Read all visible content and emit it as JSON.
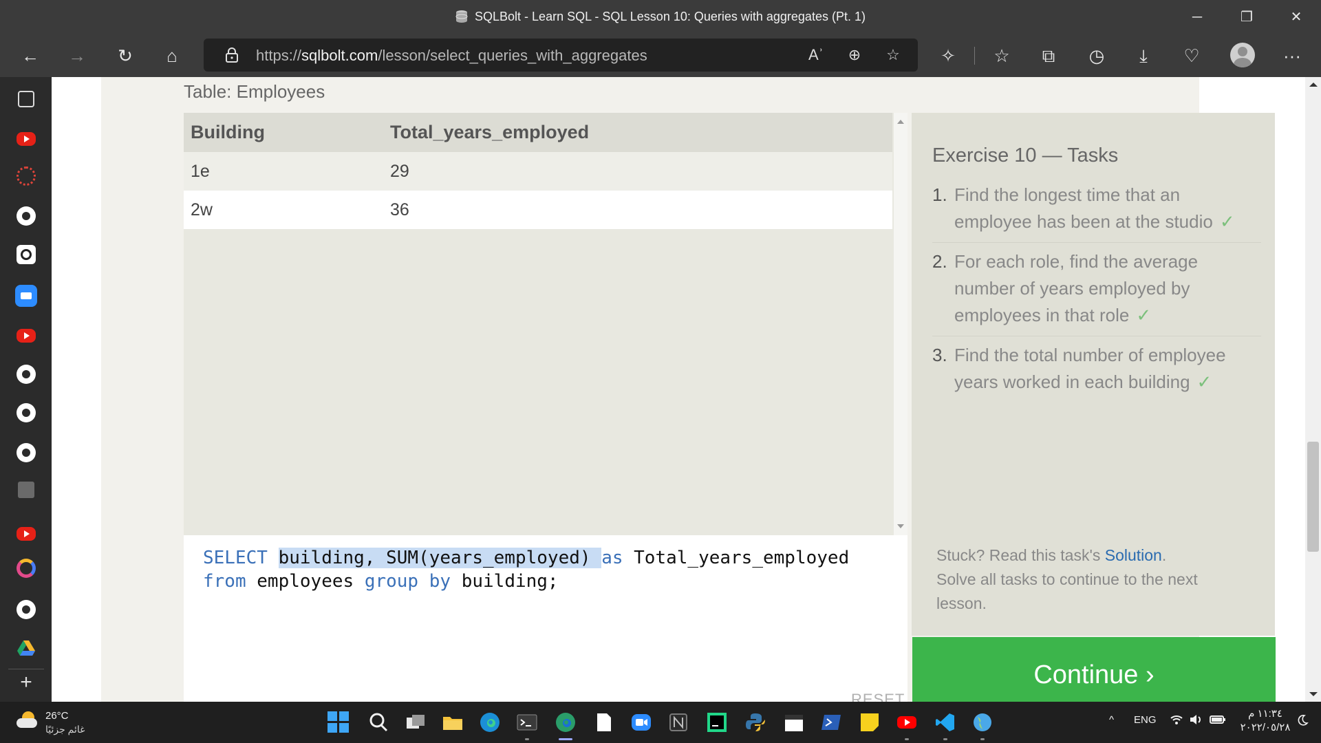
{
  "window": {
    "title": "SQLBolt - Learn SQL - SQL Lesson 10: Queries with aggregates (Pt. 1)",
    "minimize_icon": "─",
    "restore_icon": "❐",
    "close_icon": "✕"
  },
  "toolbar": {
    "back_icon": "←",
    "forward_icon": "→",
    "refresh_icon": "↻",
    "home_icon": "⌂",
    "url_scheme": "https://",
    "url_host": "sqlbolt.com",
    "url_path": "/lesson/select_queries_with_aggregates",
    "read_aloud_icon": "Aʾ",
    "zoom_icon": "⊕",
    "favorite_add_icon": "☆",
    "extensions_icon": "✧",
    "favorites_icon": "☆",
    "collections_icon": "⧉",
    "history_icon": "◷",
    "downloads_icon": "⤓",
    "performance_icon": "♡",
    "more_icon": "···"
  },
  "page": {
    "table_caption": "Table: Employees",
    "results": {
      "columns": [
        "Building",
        "Total_years_employed"
      ],
      "rows": [
        [
          "1e",
          "29"
        ],
        [
          "2w",
          "36"
        ]
      ]
    },
    "editor": {
      "line1": {
        "kw_select": "SELECT",
        "selected": "building, SUM(years_employed) ",
        "kw_as": "as",
        "rest": " Total_years_employed"
      },
      "line2": {
        "kw_from": "from",
        "table": " employees ",
        "kw_group_by": "group by",
        "rest": " building;"
      },
      "reset_label": "RESET"
    },
    "tasks": {
      "heading": "Exercise 10 — Tasks",
      "items": [
        {
          "number": "1.",
          "text": "Find the longest time that an employee has been at the studio",
          "check": "✓"
        },
        {
          "number": "2.",
          "text": "For each role, find the average number of years employed by employees in that role",
          "check": "✓"
        },
        {
          "number": "3.",
          "text": "Find the total number of employee years worked in each building",
          "check": "✓"
        }
      ],
      "stuck_prefix": "Stuck? Read this task's ",
      "solution_link": "Solution",
      "stuck_suffix": ".",
      "solve_all": "Solve all tasks to continue to the next lesson."
    },
    "continue_label": "Continue ›"
  },
  "sidebar": {
    "items": [
      "tab-actions",
      "youtube",
      "canvas",
      "github",
      "codewars",
      "zoom",
      "youtube",
      "github",
      "github",
      "github",
      "building",
      "youtube",
      "swirl",
      "github",
      "google-drive"
    ],
    "add_icon": "+"
  },
  "taskbar": {
    "weather_temp": "26°C",
    "weather_desc": "غائم جزئيًا",
    "language": "ENG",
    "chevron": "^",
    "time": "١١:٣٤ م",
    "date": "٢٠٢٢/٠٥/٢٨",
    "colors": {
      "accent": "#3ea6f5"
    }
  }
}
